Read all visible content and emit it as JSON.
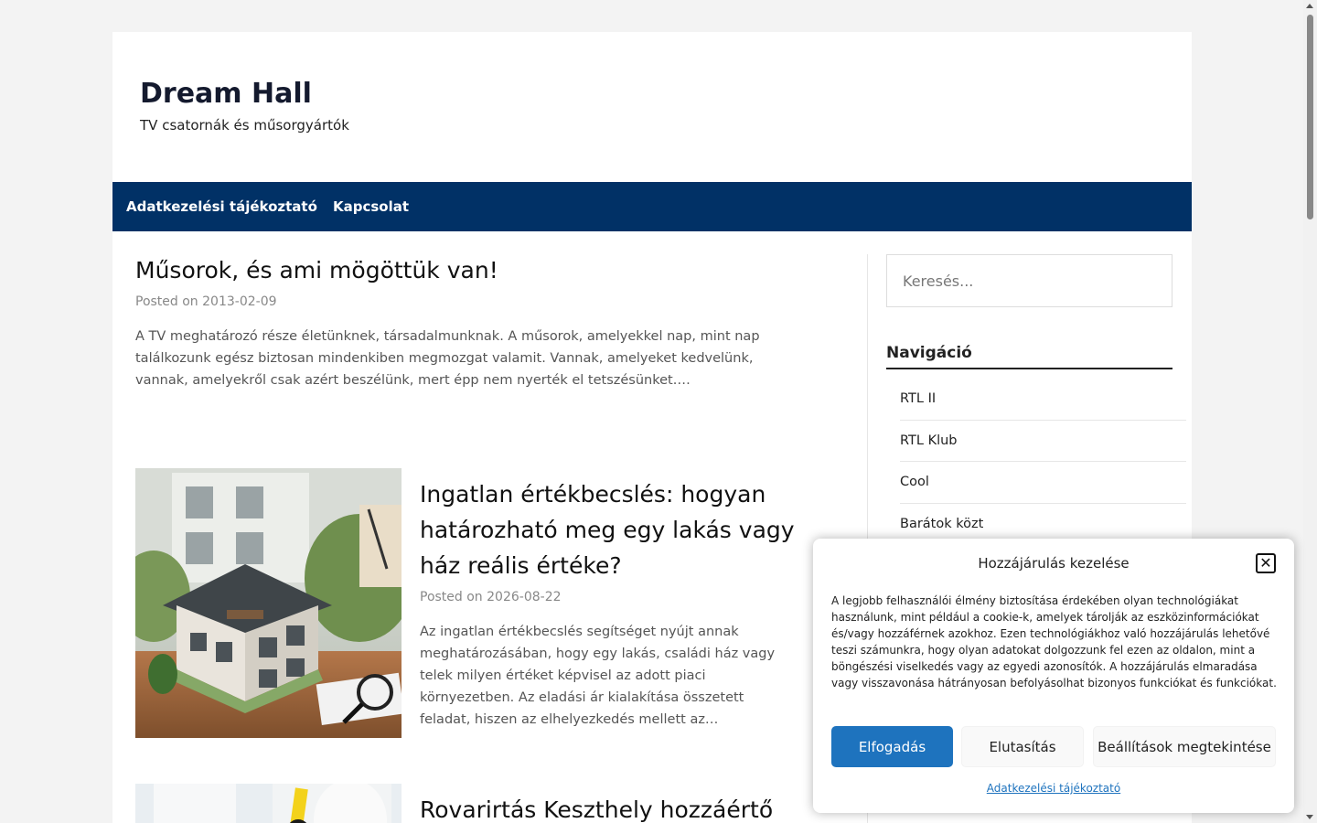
{
  "header": {
    "site_title": "Dream Hall",
    "site_description": "TV csatornák és műsorgyártók"
  },
  "nav": {
    "items": [
      {
        "label": "Adatkezelési tájékoztató"
      },
      {
        "label": "Kapcsolat"
      }
    ]
  },
  "posts": [
    {
      "title": "Műsorok, és ami mögöttük van!",
      "posted_prefix": "Posted on",
      "date": "2013-02-09",
      "excerpt": "A TV meghatározó része életünknek, társadalmunknak. A műsorok, amelyekkel nap, mint nap találkozunk egész biztosan mindenkiben megmozgat valamit. Vannak, amelyeket kedvelünk, vannak, amelyekről csak azért beszélünk, mert épp nem nyerték el tetszésünket.…"
    },
    {
      "title": "Ingatlan értékbecslés: hogyan határozható meg egy lakás vagy ház reális értéke?",
      "posted_prefix": "Posted on",
      "date": "2026-08-22",
      "excerpt": " Az ingatlan értékbecslés segítséget nyújt annak meghatározásában, hogy egy lakás, családi ház vagy telek milyen értéket képvisel az adott piaci környezetben. Az eladási ár kialakítása összetett feladat, hiszen az elhelyezkedés mellett az…"
    },
    {
      "title": "Rovarirtás Keszthely hozzáértő szakembereivel"
    }
  ],
  "sidebar": {
    "search_placeholder": "Keresés...",
    "widget_title": "Navigáció",
    "nav_items": [
      "RTL II",
      "RTL Klub",
      "Cool",
      "Barátok közt"
    ]
  },
  "consent": {
    "title": "Hozzájárulás kezelése",
    "text": "A legjobb felhasználói élmény biztosítása érdekében olyan technológiákat használunk, mint például a cookie-k, amelyek tárolják az eszközinformációkat és/vagy hozzáférnek azokhoz. Ezen technológiákhoz való hozzájárulás lehetővé teszi számunkra, hogy olyan adatokat dolgozzunk fel ezen az oldalon, mint a böngészési viselkedés vagy az egyedi azonosítók. A hozzájárulás elmaradása vagy visszavonása hátrányosan befolyásolhat bizonyos funkciókat és funkciókat.",
    "accept_label": "Elfogadás",
    "deny_label": "Elutasítás",
    "settings_label": "Beállítások megtekintése",
    "policy_link": "Adatkezelési tájékoztató",
    "accent_color": "#1e73be"
  },
  "colors": {
    "nav_bg": "#013166",
    "page_bg": "#f3f3f3"
  }
}
